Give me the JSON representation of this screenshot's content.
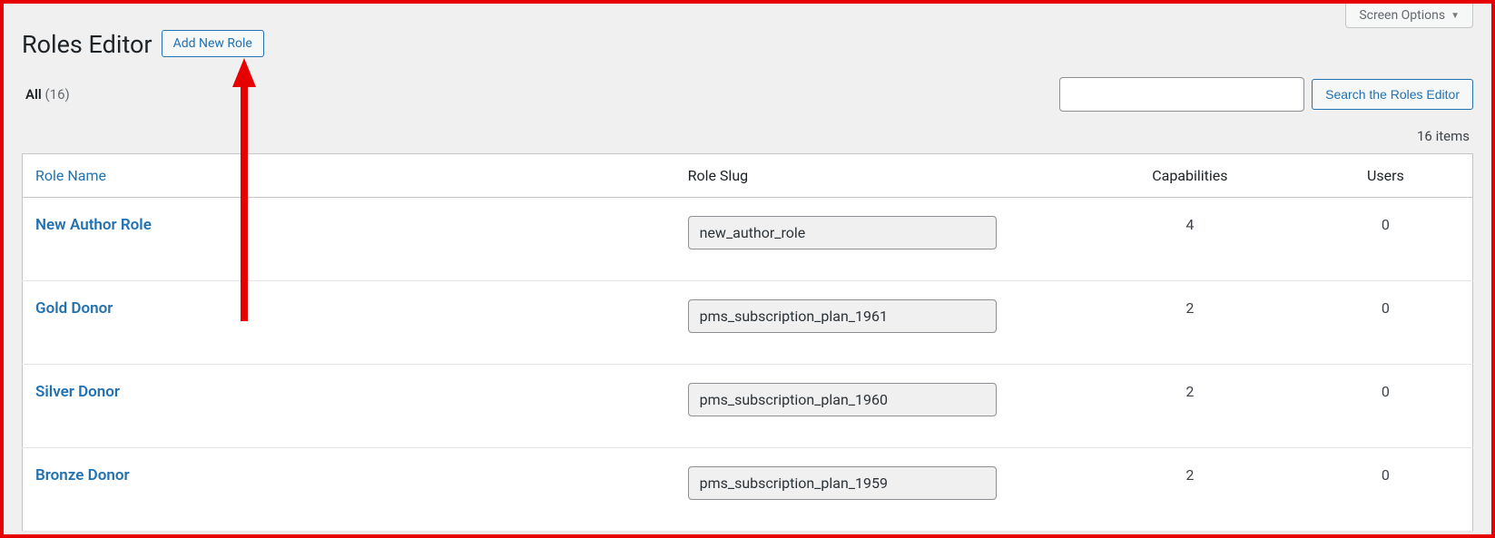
{
  "screen_options_label": "Screen Options",
  "page_title": "Roles Editor",
  "add_button_label": "Add New Role",
  "filter": {
    "label": "All",
    "count": "(16)"
  },
  "search": {
    "value": "",
    "button_label": "Search the Roles Editor"
  },
  "items_count_label": "16 items",
  "columns": {
    "name": "Role Name",
    "slug": "Role Slug",
    "capabilities": "Capabilities",
    "users": "Users"
  },
  "rows": [
    {
      "name": "New Author Role",
      "slug": "new_author_role",
      "capabilities": "4",
      "users": "0"
    },
    {
      "name": "Gold Donor",
      "slug": "pms_subscription_plan_1961",
      "capabilities": "2",
      "users": "0"
    },
    {
      "name": "Silver Donor",
      "slug": "pms_subscription_plan_1960",
      "capabilities": "2",
      "users": "0"
    },
    {
      "name": "Bronze Donor",
      "slug": "pms_subscription_plan_1959",
      "capabilities": "2",
      "users": "0"
    }
  ]
}
